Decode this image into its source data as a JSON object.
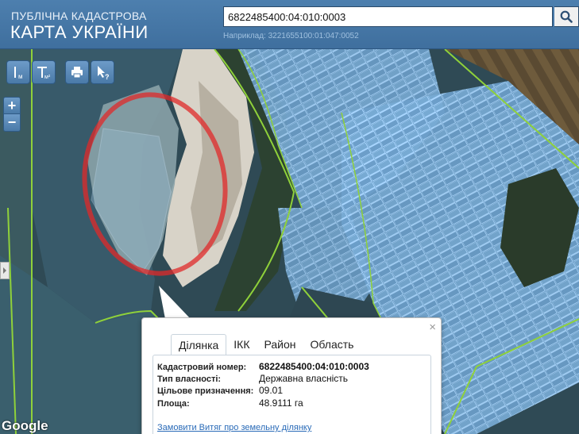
{
  "header": {
    "title_line1": "ПУБЛІЧНА КАДАСТРОВА",
    "title_line2": "КАРТА УКРАЇНИ"
  },
  "search": {
    "value": "6822485400:04:010:0003",
    "hint": "Наприклад: 3221655100:01:047:0052",
    "button_icon": "search-icon"
  },
  "toolbar": {
    "measure_length_label": "м",
    "measure_area_label": "м²",
    "print_icon": "printer-icon",
    "identify_icon": "cursor-question-icon"
  },
  "zoom": {
    "in_label": "+",
    "out_label": "−"
  },
  "map": {
    "attribution": "Google"
  },
  "popup": {
    "close_label": "×",
    "tabs": [
      {
        "label": "Ділянка",
        "active": true
      },
      {
        "label": "ІКК",
        "active": false
      },
      {
        "label": "Район",
        "active": false
      },
      {
        "label": "Область",
        "active": false
      }
    ],
    "fields": [
      {
        "label": "Кадастровий номер:",
        "value": "6822485400:04:010:0003",
        "bold": true
      },
      {
        "label": "Тип власності:",
        "value": "Державна власність",
        "bold": false
      },
      {
        "label": "Цільове призначення:",
        "value": "09.01",
        "bold": false
      },
      {
        "label": "Площа:",
        "value": "48.9111 га",
        "bold": false
      }
    ],
    "link": "Замовити Витяг про земельну ділянку"
  },
  "colors": {
    "header_bg": "#4677a6",
    "parcel_fill": "#6fa8d8",
    "parcel_stroke": "#9fd0ff",
    "boundary": "#8fd13a",
    "highlight": "#e02a2a",
    "link": "#2a6bb8"
  }
}
